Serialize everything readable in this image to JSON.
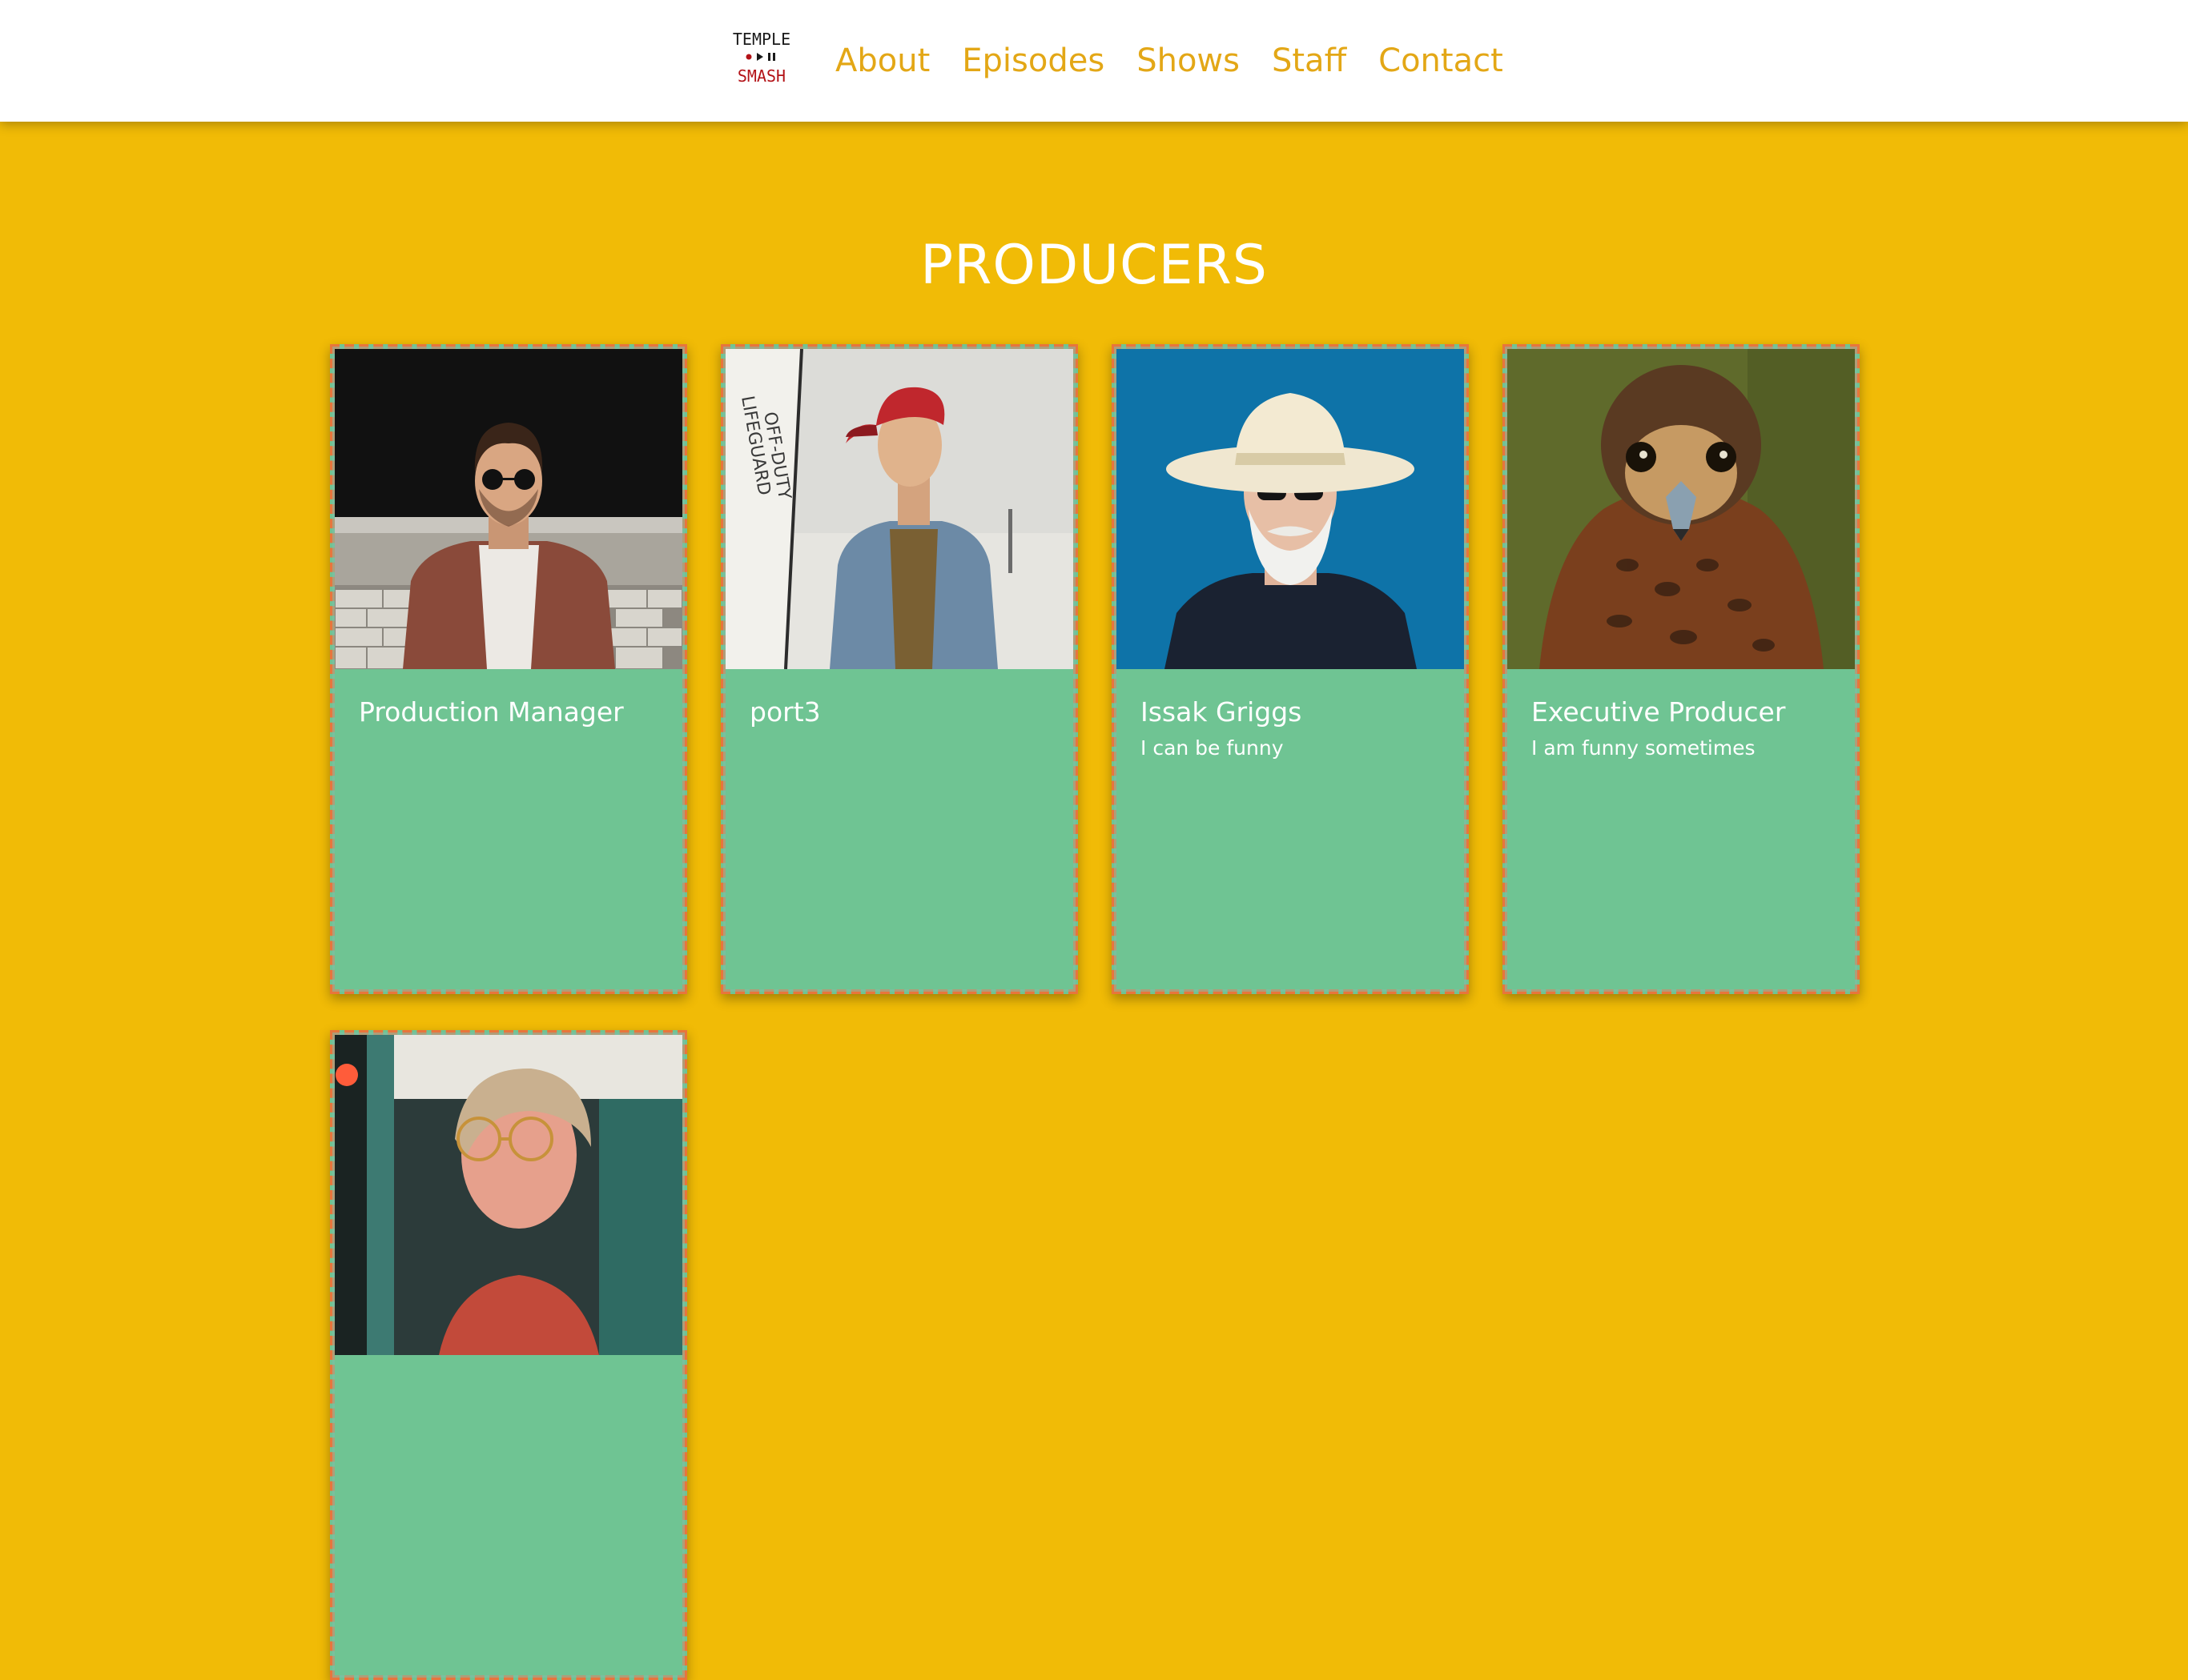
{
  "header": {
    "logo": {
      "line1": "TEMPLE",
      "line2": "SMASH",
      "colors": {
        "top": "#1a1a1a",
        "bottom": "#B31217"
      }
    },
    "nav": [
      {
        "label": "About"
      },
      {
        "label": "Episodes"
      },
      {
        "label": "Shows"
      },
      {
        "label": "Staff"
      },
      {
        "label": "Contact"
      }
    ]
  },
  "section": {
    "title": "PRODUCERS"
  },
  "cards": [
    {
      "photo_icon": "man-sunglasses-brown-shirt-photo",
      "name": "Production Manager",
      "subtitle": ""
    },
    {
      "photo_icon": "man-red-cap-denim-jacket-photo",
      "name": "port3",
      "subtitle": ""
    },
    {
      "photo_icon": "old-man-cowboy-hat-photo",
      "name": "Issak Griggs",
      "subtitle": "I can be funny"
    },
    {
      "photo_icon": "falcon-photo",
      "name": "Executive Producer",
      "subtitle": "I am funny sometimes"
    },
    {
      "photo_icon": "woman-round-glasses-photo",
      "name": "",
      "subtitle": ""
    }
  ],
  "colors": {
    "page_background": "#F1BB06",
    "nav_link": "#E3A716",
    "card_background": "#6FC493",
    "card_border": "#E8753C"
  }
}
